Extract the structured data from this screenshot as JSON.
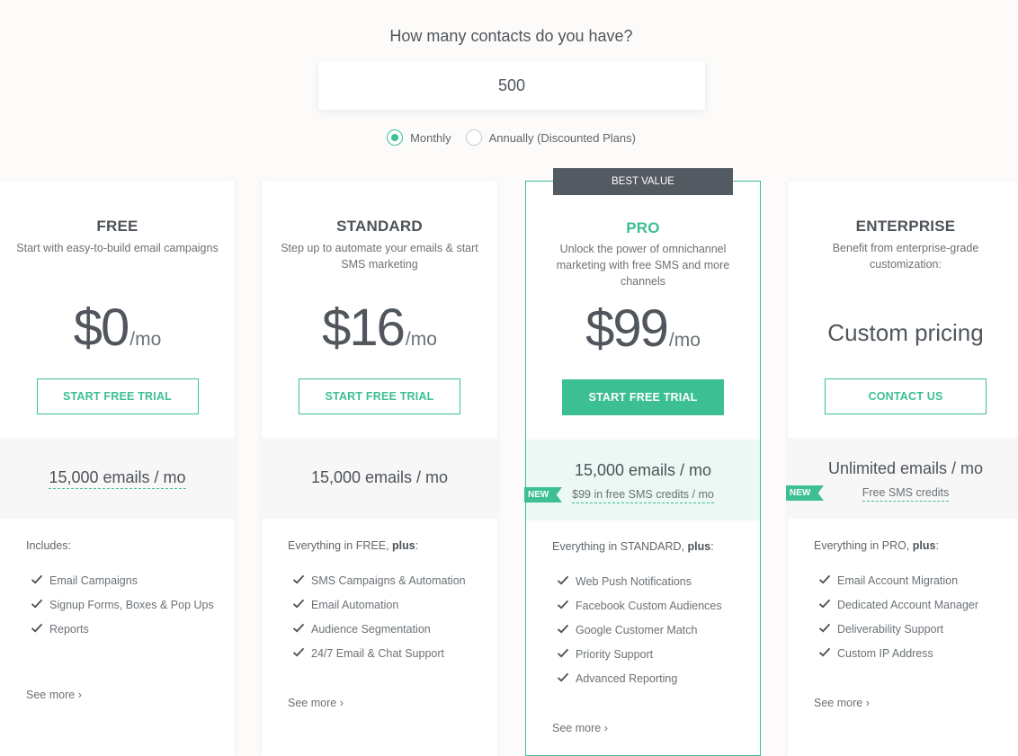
{
  "header": {
    "question": "How many contacts do you have?",
    "contacts_value": "500",
    "billing_options": [
      {
        "label": "Monthly",
        "selected": true
      },
      {
        "label": "Annually (Discounted Plans)",
        "selected": false
      }
    ]
  },
  "colors": {
    "accent": "#3cbf93",
    "badge_dark": "#545a62",
    "text": "#4d5359"
  },
  "plans": [
    {
      "name": "FREE",
      "description": "Start with easy-to-build email campaigns",
      "price": "$0",
      "per": "/mo",
      "button": "START FREE TRIAL",
      "emails": "15,000 emails / mo",
      "includes_prefix": "Includes:",
      "features": [
        "Email Campaigns",
        "Signup Forms, Boxes & Pop Ups",
        "Reports"
      ],
      "see_more": "See more"
    },
    {
      "name": "STANDARD",
      "description": "Step up to automate your emails & start SMS marketing",
      "price": "$16",
      "per": "/mo",
      "button": "START FREE TRIAL",
      "emails": "15,000 emails / mo",
      "includes_prefix": "Everything in FREE, ",
      "includes_bold": "plus",
      "includes_suffix": ":",
      "features": [
        "SMS Campaigns & Automation",
        "Email Automation",
        "Audience Segmentation",
        "24/7 Email & Chat Support"
      ],
      "see_more": "See more"
    },
    {
      "name": "PRO",
      "badge": "BEST VALUE",
      "description": "Unlock the power of omnichannel marketing with free SMS and more channels",
      "price": "$99",
      "per": "/mo",
      "button": "START FREE TRIAL",
      "emails": "15,000 emails / mo",
      "new_label": "NEW",
      "sms_credits": "$99 in free SMS credits / mo",
      "includes_prefix": "Everything in STANDARD, ",
      "includes_bold": "plus",
      "includes_suffix": ":",
      "features": [
        "Web Push Notifications",
        "Facebook Custom Audiences",
        "Google Customer Match",
        "Priority Support",
        "Advanced Reporting"
      ],
      "see_more": "See more"
    },
    {
      "name": "ENTERPRISE",
      "description": "Benefit from enterprise-grade customization:",
      "price_text": "Custom pricing",
      "button": "CONTACT US",
      "emails": "Unlimited emails / mo",
      "new_label": "NEW",
      "sms_credits": "Free SMS credits",
      "includes_prefix": "Everything in PRO, ",
      "includes_bold": "plus",
      "includes_suffix": ":",
      "features": [
        "Email Account Migration",
        "Dedicated Account Manager",
        "Deliverability Support",
        "Custom IP Address"
      ],
      "see_more": "See more"
    }
  ]
}
